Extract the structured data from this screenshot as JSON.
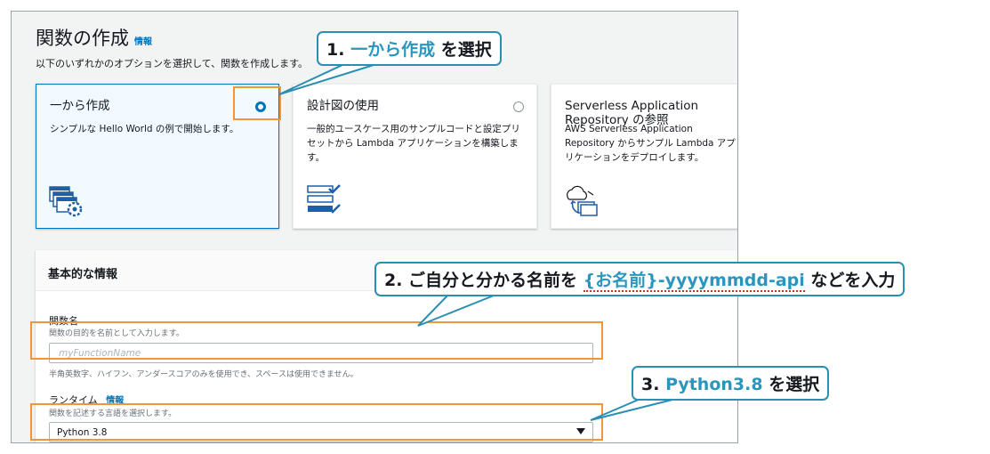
{
  "page": {
    "title": "関数の作成",
    "title_info": "情報",
    "subtitle": "以下のいずれかのオプションを選択して、関数を作成します。"
  },
  "options": [
    {
      "title": "一から作成",
      "desc": "シンプルな Hello World の例で開始します。",
      "selected": true
    },
    {
      "title": "設計図の使用",
      "desc": "一般的ユースケース用のサンプルコードと設定プリセットから Lambda アプリケーションを構築します。",
      "selected": false
    },
    {
      "title": "Serverless Application Repository の参照",
      "desc": "AWS Serverless Application Repository からサンプル Lambda アプリケーションをデプロイします。",
      "selected": false
    }
  ],
  "basic_info": {
    "title": "基本的な情報",
    "function_name_label": "関数名",
    "function_name_desc": "関数の目的を名前として入力します。",
    "function_name_placeholder": "myFunctionName",
    "function_name_hint": "半角英数字、ハイフン、アンダースコアのみを使用でき、スペースは使用できません。",
    "runtime_label": "ランタイム",
    "runtime_info": "情報",
    "runtime_desc": "関数を記述する言語を選択します。",
    "runtime_value": "Python 3.8"
  },
  "callouts": {
    "c1_prefix": "1. ",
    "c1_highlight": "一から作成",
    "c1_suffix": " を選択",
    "c2_prefix": "2. ご自分と分かる名前を ",
    "c2_highlight": "{お名前}-yyyymmdd-api",
    "c2_suffix": " などを入力",
    "c3_prefix": "3. ",
    "c3_highlight": "Python3.8",
    "c3_suffix": " を選択"
  },
  "colors": {
    "accent_blue": "#0073bb",
    "callout_border": "#2b8fb3",
    "highlight_orange": "#f0963a"
  }
}
